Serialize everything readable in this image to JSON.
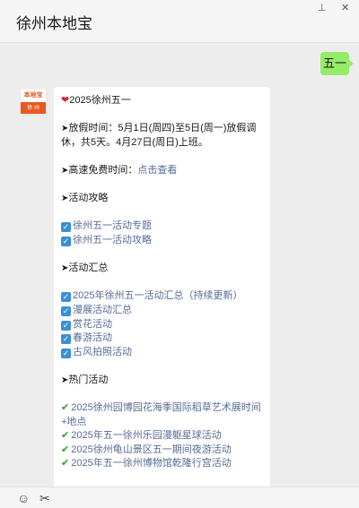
{
  "window": {
    "title": "徐州本地宝",
    "pin_glyph": "⊥",
    "close_glyph": "✕"
  },
  "my_message": "五一",
  "sender_avatar": {
    "top_text": "本地宝",
    "bottom_text": "徐 州"
  },
  "reply": {
    "heart_glyph": "❤",
    "arrow_glyph": "➤",
    "check_glyph": "✓",
    "tick_glyph": "✔",
    "header": "2025徐州五一",
    "holiday_label": "放假时间：5月1日(周四)至5日(周一)放假调休，共5天。4月27日(周日)上班。",
    "highway_label": "高速免费时间：",
    "highway_link": "点击查看",
    "guide_title": "活动攻略",
    "guide_links": [
      "徐州五一活动专题",
      "徐州五一活动攻略"
    ],
    "summary_title": "活动汇总",
    "summary_links": [
      "2025年徐州五一活动汇总（持续更新）",
      "漫展活动汇总",
      "赏花活动",
      "春游活动",
      "古风拍照活动"
    ],
    "hot_title": "热门活动",
    "hot_links": [
      "2025徐州园博园花海季国际稻草艺术展时间+地点",
      "2025年五一徐州乐园漫躯星球活动",
      "2025徐州龟山景区五一期间夜游活动",
      "2025年五一徐州博物馆乾隆行宫活动"
    ]
  },
  "toolbar": {
    "emoji_glyph": "☺",
    "scissors_glyph": "✂"
  }
}
